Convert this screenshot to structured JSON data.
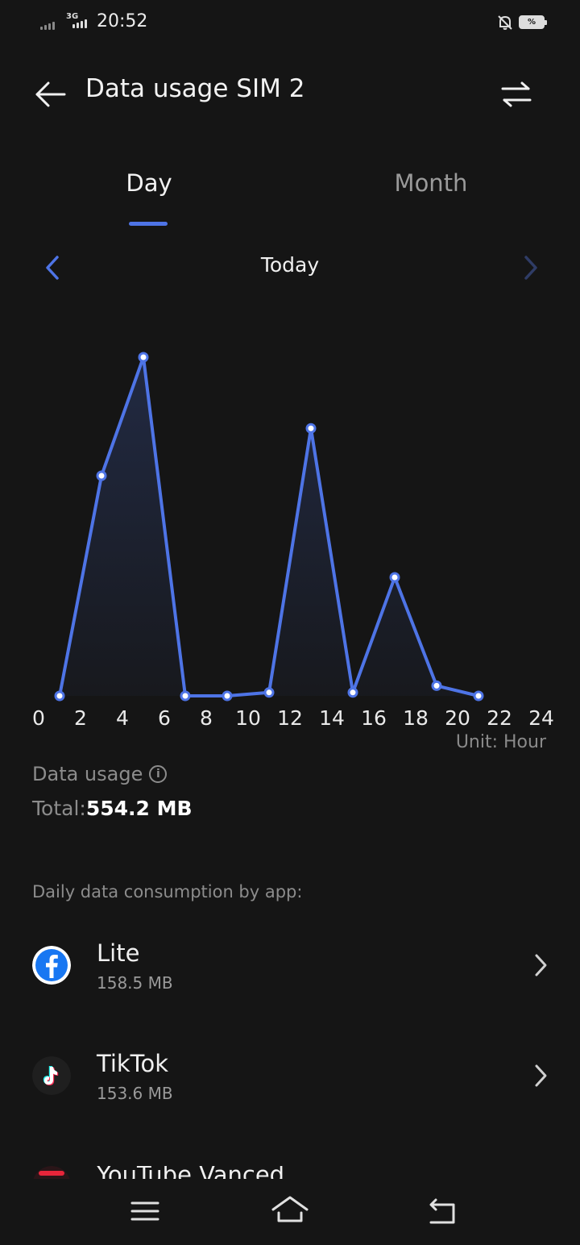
{
  "status_bar": {
    "network_type": "3G",
    "time": "20:52",
    "battery_text": "%",
    "icons": [
      "signal-sim1-icon",
      "signal-sim2-icon",
      "bell-off-icon",
      "battery-icon"
    ]
  },
  "header": {
    "title": "Data usage SIM 2",
    "back_icon": "arrow-left-icon",
    "action_icon": "swap-arrows-icon"
  },
  "tabs": [
    {
      "label": "Day",
      "active": true
    },
    {
      "label": "Month",
      "active": false
    }
  ],
  "period": {
    "label": "Today",
    "prev_icon": "chevron-left-icon",
    "next_icon": "chevron-right-icon"
  },
  "chart_data": {
    "type": "line",
    "x": [
      1,
      3,
      5,
      7,
      9,
      11,
      13,
      15,
      17,
      19,
      21
    ],
    "values": [
      0,
      65,
      100,
      0,
      0,
      1,
      79,
      1,
      35,
      3,
      0
    ],
    "xticks": [
      "0",
      "2",
      "4",
      "6",
      "8",
      "10",
      "12",
      "14",
      "16",
      "18",
      "20",
      "22",
      "24"
    ],
    "xlim": [
      0,
      24
    ],
    "ylim": [
      0,
      100
    ],
    "unit_label": "Unit: Hour",
    "line_color": "#4e74e6",
    "grid": false
  },
  "usage": {
    "label": "Data usage",
    "total_label": "Total:",
    "total_value": "554.2 MB"
  },
  "apps": {
    "section_label": "Daily data consumption by app:",
    "items": [
      {
        "name": "Lite",
        "size": "158.5 MB",
        "icon": "facebook-lite-icon"
      },
      {
        "name": "TikTok",
        "size": "153.6 MB",
        "icon": "tiktok-icon"
      },
      {
        "name": "YouTube Vanced",
        "size": "",
        "icon": "youtube-vanced-icon"
      }
    ]
  },
  "nav_bar": {
    "icons": [
      "menu-icon",
      "home-icon",
      "return-icon"
    ]
  },
  "colors": {
    "background": "#151515",
    "accent": "#4e74e6"
  }
}
